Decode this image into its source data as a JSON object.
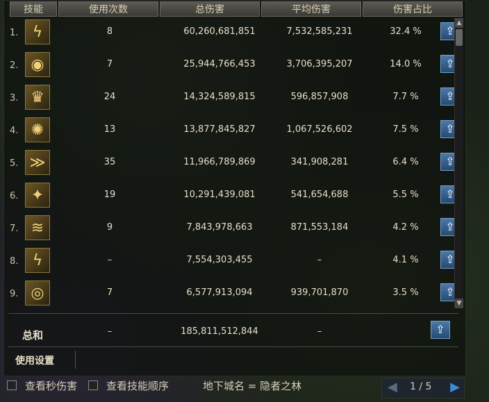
{
  "headers": [
    "技能",
    "使用次数",
    "总伤害",
    "平均伤害",
    "伤害占比"
  ],
  "rows": [
    {
      "index": "1.",
      "icon": "skill-lightning-icon",
      "glyph": "ϟ",
      "uses": "8",
      "total": "60,260,681,851",
      "avg": "7,532,585,231",
      "pct": "32.4 %"
    },
    {
      "index": "2.",
      "icon": "skill-eye-icon",
      "glyph": "◉",
      "uses": "7",
      "total": "25,944,766,453",
      "avg": "3,706,395,207",
      "pct": "14.0 %"
    },
    {
      "index": "3.",
      "icon": "skill-crown-icon",
      "glyph": "♛",
      "uses": "24",
      "total": "14,324,589,815",
      "avg": "596,857,908",
      "pct": "7.7 %"
    },
    {
      "index": "4.",
      "icon": "skill-burst-icon",
      "glyph": "✺",
      "uses": "13",
      "total": "13,877,845,827",
      "avg": "1,067,526,602",
      "pct": "7.5 %"
    },
    {
      "index": "5.",
      "icon": "skill-slash-icon",
      "glyph": "≫",
      "uses": "35",
      "total": "11,966,789,869",
      "avg": "341,908,281",
      "pct": "6.4 %"
    },
    {
      "index": "6.",
      "icon": "skill-kick-icon",
      "glyph": "✦",
      "uses": "19",
      "total": "10,291,439,081",
      "avg": "541,654,688",
      "pct": "5.5 %"
    },
    {
      "index": "7.",
      "icon": "skill-claw-icon",
      "glyph": "≋",
      "uses": "9",
      "total": "7,843,978,663",
      "avg": "871,553,184",
      "pct": "4.2 %"
    },
    {
      "index": "8.",
      "icon": "skill-green-lightning-icon",
      "glyph": "ϟ",
      "uses": "–",
      "total": "7,554,303,455",
      "avg": "–",
      "pct": "4.1 %"
    },
    {
      "index": "9.",
      "icon": "skill-ring-icon",
      "glyph": "◎",
      "uses": "7",
      "total": "6,577,913,094",
      "avg": "939,701,870",
      "pct": "3.5 %"
    }
  ],
  "summary": {
    "label": "总和",
    "uses": "–",
    "total": "185,811,512,844",
    "avg": "–"
  },
  "settings_label": "使用设置",
  "bottom": {
    "checkbox1": "查看秒伤害",
    "checkbox2": "查看技能顺序",
    "dungeon": "地下城名 = 隐者之林",
    "page": "1 / 5"
  },
  "colors": {
    "share_button": "#2f5a8a",
    "header_bg": "#4a4942",
    "text": "#e7dfc8"
  }
}
